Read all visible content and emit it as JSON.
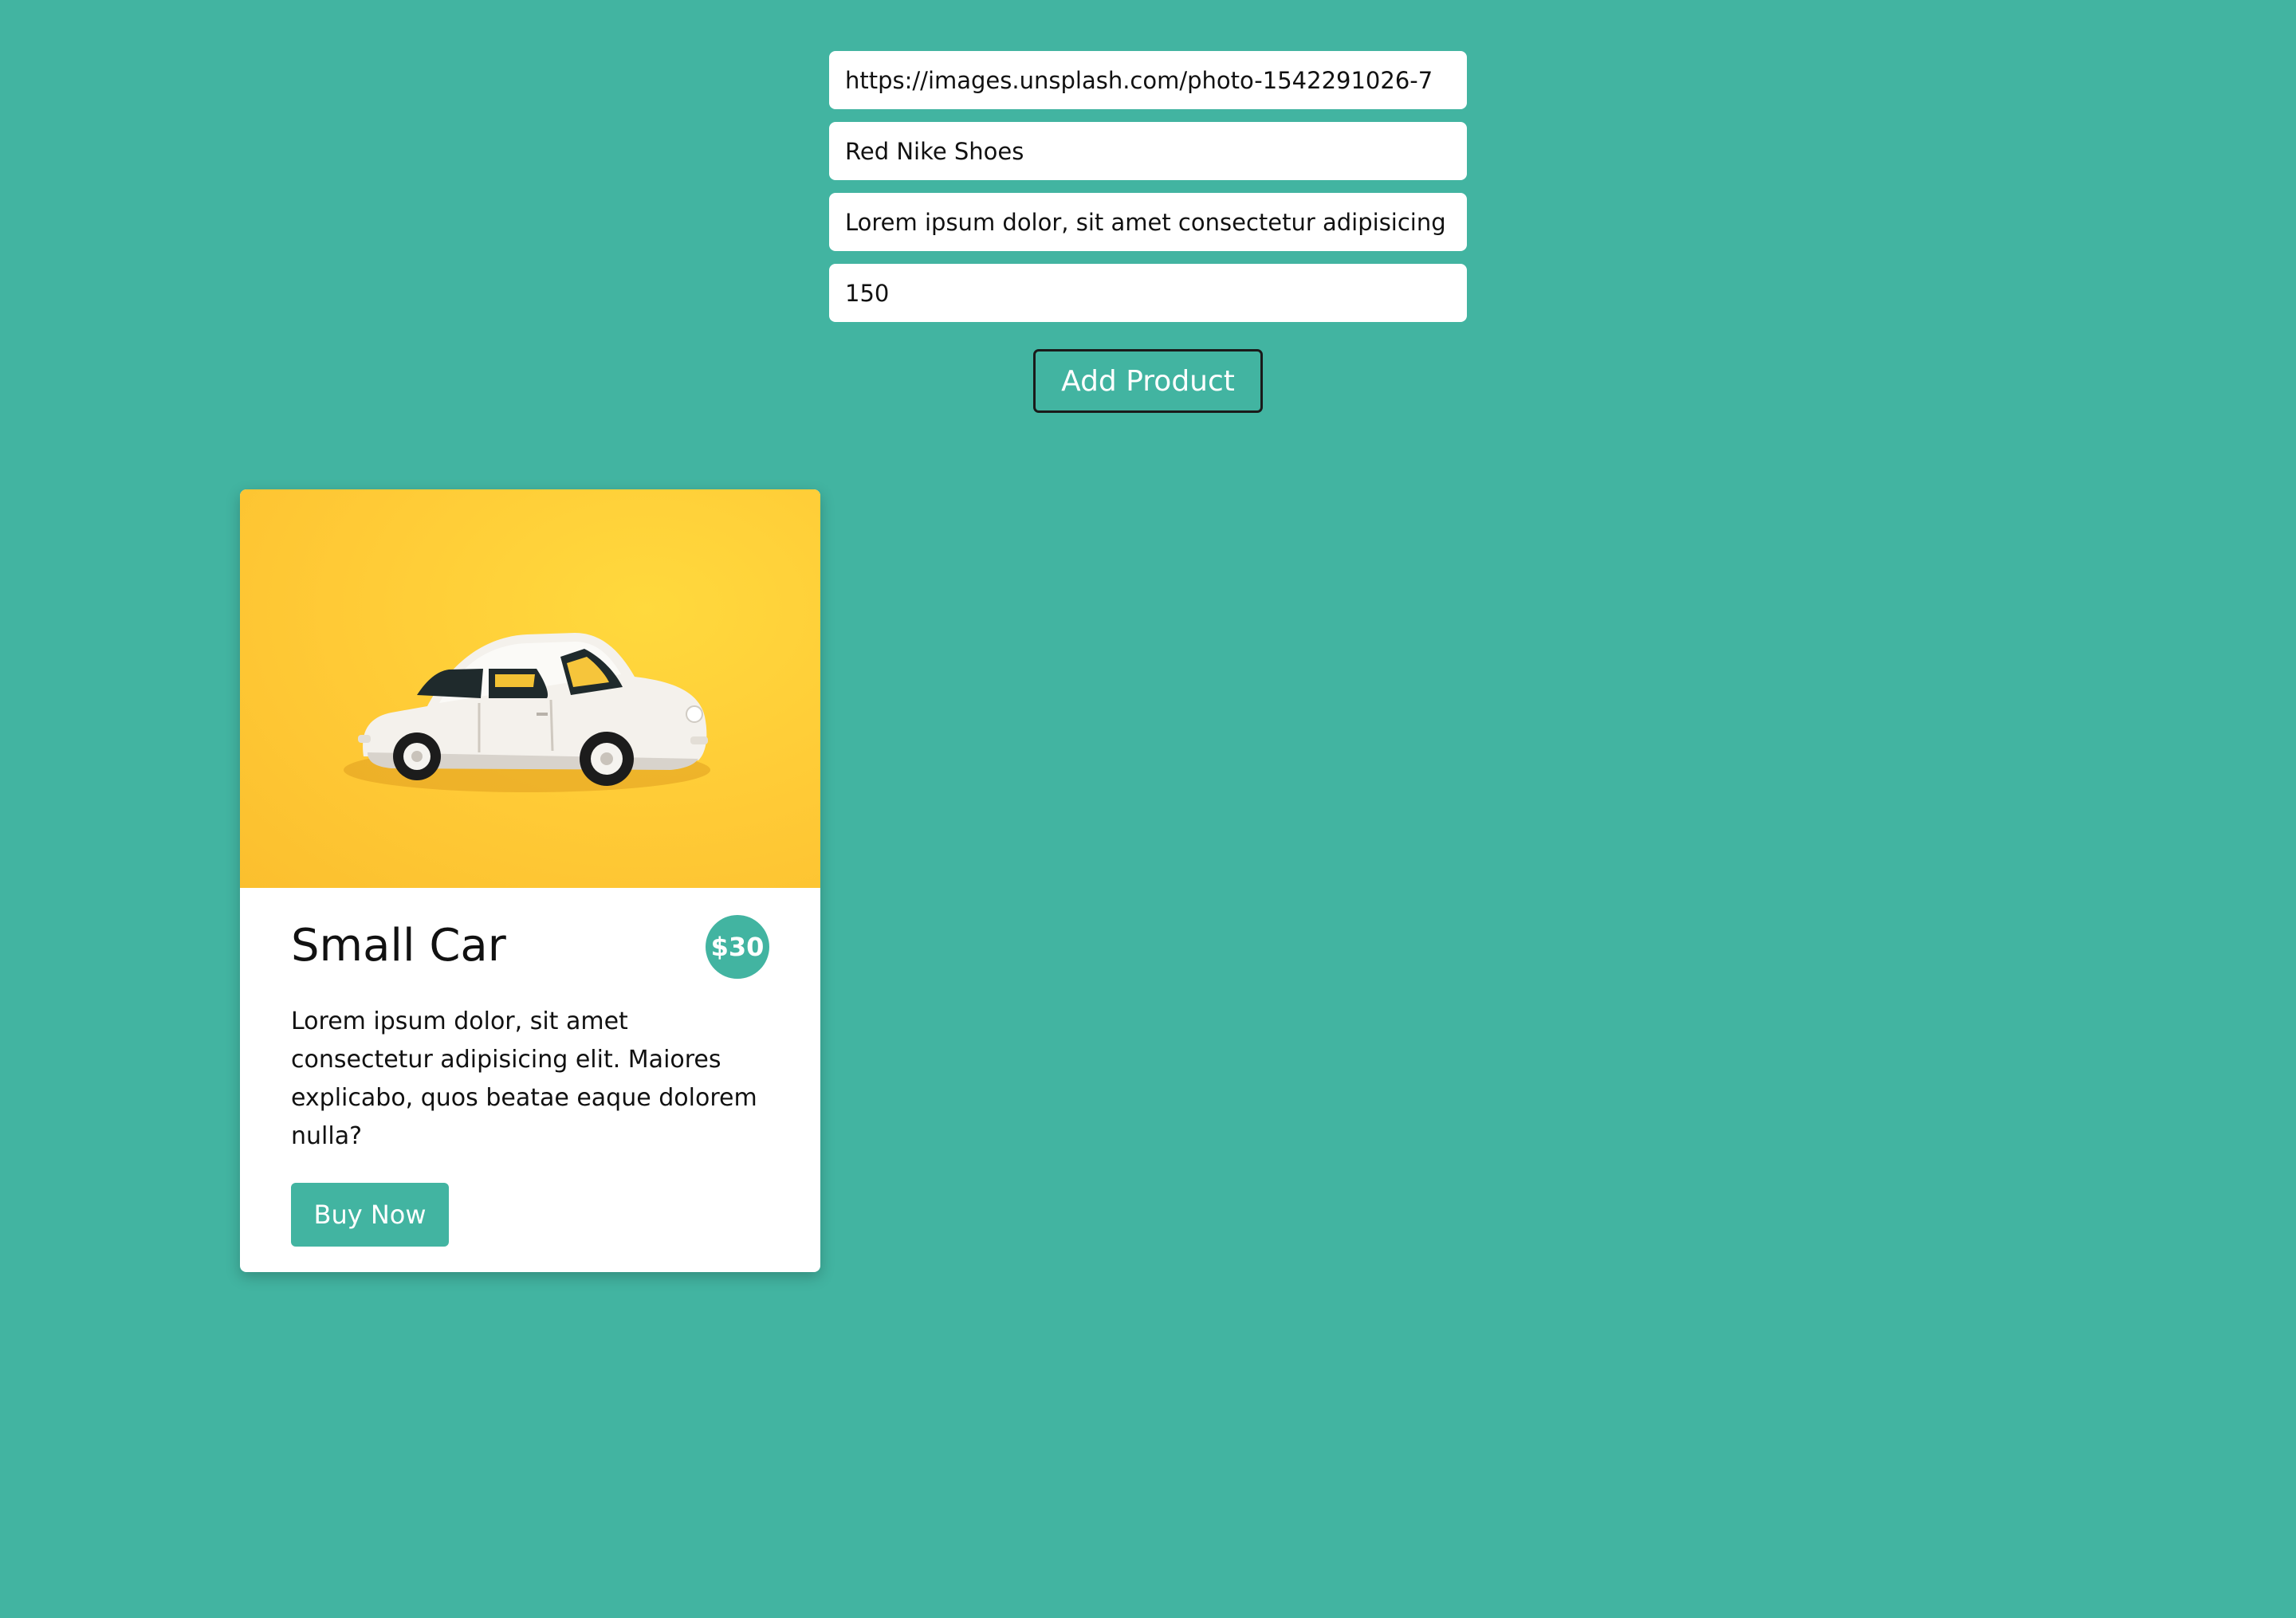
{
  "colors": {
    "background": "#42b4a1",
    "accent": "#42b4a1",
    "card": "#ffffff",
    "image_background": "#ffcb37"
  },
  "form": {
    "image_url_value": "https://images.unsplash.com/photo-1542291026-7",
    "name_value": "Red Nike Shoes",
    "description_value": "Lorem ipsum dolor, sit amet consectetur adipisicing",
    "price_value": "150",
    "add_button_label": "Add Product"
  },
  "products": [
    {
      "image": "toy-car-photo",
      "title": "Small Car",
      "price": "$30",
      "description": "Lorem ipsum dolor, sit amet consectetur adipisicing elit. Maiores explicabo, quos beatae eaque dolorem nulla?",
      "buy_label": "Buy Now"
    }
  ]
}
